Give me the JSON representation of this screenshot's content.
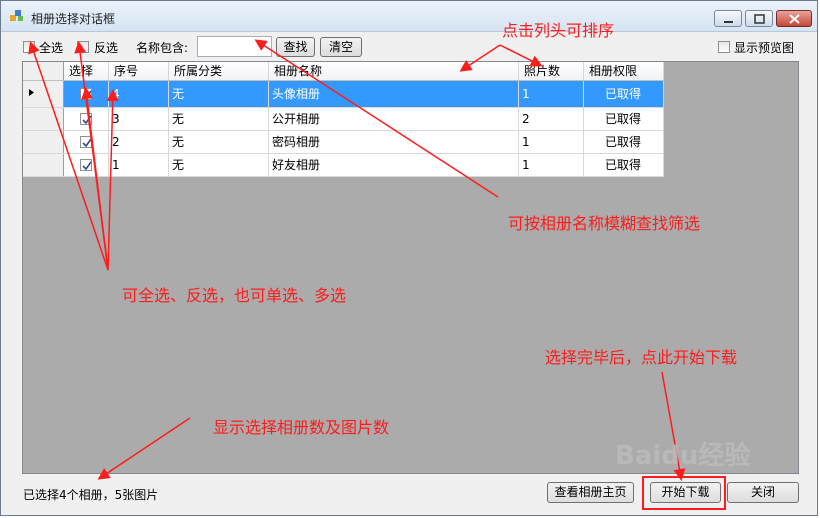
{
  "window": {
    "title": "相册选择对话框"
  },
  "toolbar": {
    "select_all": "全选",
    "invert": "反选",
    "name_contains": "名称包含:",
    "search_value": "",
    "find_button": "查找",
    "clear_button": "清空",
    "show_preview": "显示预览图"
  },
  "table": {
    "headers": [
      "选择",
      "序号",
      "所属分类",
      "相册名称",
      "照片数",
      "相册权限"
    ],
    "rows": [
      {
        "checked": true,
        "index": "4",
        "category": "无",
        "name": "头像相册",
        "photos": "1",
        "permission": "已取得"
      },
      {
        "checked": true,
        "index": "3",
        "category": "无",
        "name": "公开相册",
        "photos": "2",
        "permission": "已取得"
      },
      {
        "checked": true,
        "index": "2",
        "category": "无",
        "name": "密码相册",
        "photos": "1",
        "permission": "已取得"
      },
      {
        "checked": true,
        "index": "1",
        "category": "无",
        "name": "好友相册",
        "photos": "1",
        "permission": "已取得"
      }
    ]
  },
  "status": "已选择4个相册，5张图片",
  "footer": {
    "view_home": "查看相册主页",
    "start_download": "开始下载",
    "close": "关闭"
  },
  "annotations": {
    "sort": "点击列头可排序",
    "filter": "可按相册名称模糊查找筛选",
    "select": "可全选、反选，也可单选、多选",
    "download": "选择完毕后，点此开始下载",
    "count": "显示选择相册数及图片数"
  },
  "watermark": "Baidu经验",
  "colors": {
    "annotation": "#ff1c1c",
    "selection": "#3399ff",
    "grid_bg": "#ababab"
  }
}
